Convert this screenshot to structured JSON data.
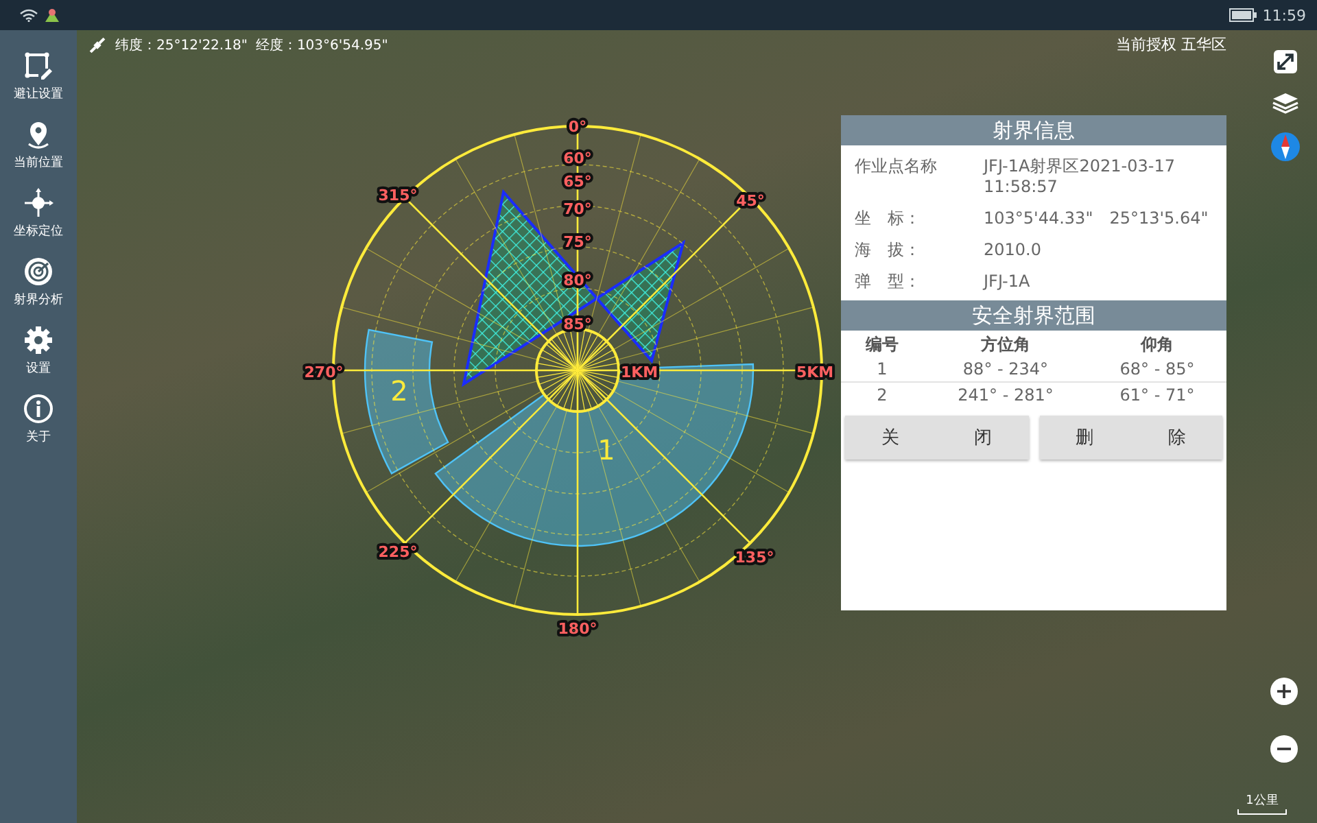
{
  "status_bar": {
    "time": "11:59"
  },
  "sidebar": {
    "items": [
      {
        "kind": "avoid",
        "label": "避让设置"
      },
      {
        "kind": "location",
        "label": "当前位置"
      },
      {
        "kind": "coordinate",
        "label": "坐标定位"
      },
      {
        "kind": "analysis",
        "label": "射界分析"
      },
      {
        "kind": "settings",
        "label": "设置"
      },
      {
        "kind": "about",
        "label": "关于"
      }
    ]
  },
  "map": {
    "latitude": "纬度：25°12'22.18\"",
    "longitude": "经度：103°6'54.95\"",
    "authorization": "当前授权 五华区",
    "scale": "1公里"
  },
  "range_diagram": {
    "angle_labels": [
      "0°",
      "60°",
      "65°",
      "70°",
      "75°",
      "80°",
      "85°",
      "45°",
      "135°",
      "180°",
      "225°",
      "315°",
      "270°"
    ],
    "distance_labels": [
      "1KM",
      "5KM"
    ],
    "sectors": [
      {
        "label": "1"
      },
      {
        "label": "2"
      }
    ]
  },
  "info_panel": {
    "title": "射界信息",
    "fields": [
      {
        "label": "作业点名称",
        "value": "JFJ-1A射界区2021-03-17 11:58:57"
      },
      {
        "label": "坐　标：",
        "value": "103°5'44.33\"　25°13'5.64\""
      },
      {
        "label": "海　拔：",
        "value": "2010.0"
      },
      {
        "label": "弹　型：",
        "value": "JFJ-1A"
      }
    ],
    "range_title": "安全射界范围",
    "columns": [
      "编号",
      "方位角",
      "仰角"
    ],
    "rows": [
      [
        "1",
        "88° - 234°",
        "68° - 85°"
      ],
      [
        "2",
        "241° - 281°",
        "61° - 71°"
      ]
    ],
    "buttons": [
      "关 闭",
      "删 除"
    ]
  }
}
